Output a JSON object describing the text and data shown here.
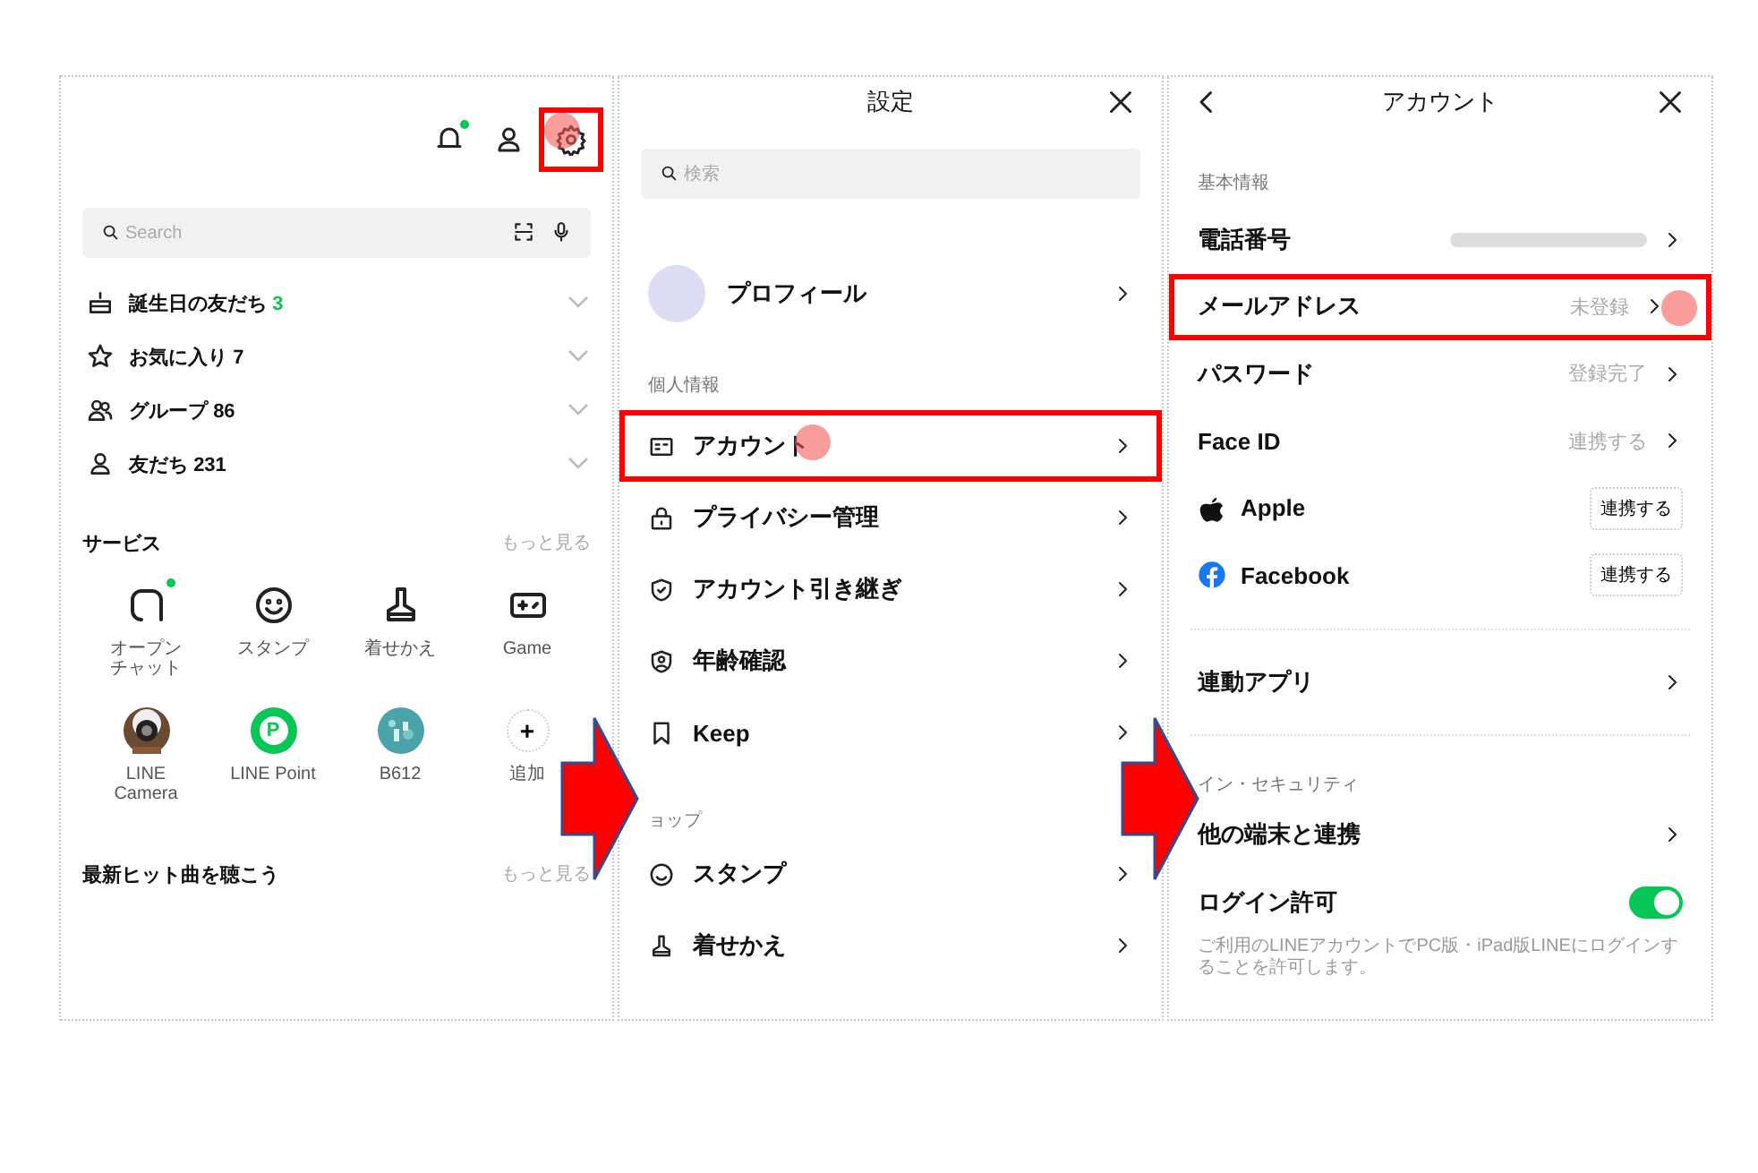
{
  "home": {
    "header_icons": [
      {
        "badge": true,
        "highlighted": false
      },
      {
        "badge": false,
        "highlighted": false
      },
      {
        "badge": false,
        "highlighted": true
      }
    ],
    "search": {
      "placeholder": "Search"
    },
    "friend_groups": [
      {
        "label": "誕生日の友だち",
        "count": "3",
        "accent": true
      },
      {
        "label": "お気に入り",
        "count": "7",
        "accent": false
      },
      {
        "label": "グループ",
        "count": "86",
        "accent": false
      },
      {
        "label": "友だち",
        "count": "231",
        "accent": false
      }
    ],
    "services": {
      "title": "サービス",
      "more": "もっと見る",
      "items": [
        {
          "lines": [
            "オープン",
            "チャット"
          ],
          "badge": true
        },
        {
          "lines": [
            "スタンプ"
          ],
          "badge": false
        },
        {
          "lines": [
            "着せかえ"
          ],
          "badge": false
        },
        {
          "lines": [
            "Game"
          ],
          "badge": false
        },
        {
          "lines": [
            "LINE",
            "Camera"
          ],
          "badge": false
        },
        {
          "lines": [
            "LINE Point"
          ],
          "badge": false,
          "glyph": "P"
        },
        {
          "lines": [
            "B612"
          ],
          "badge": false
        },
        {
          "lines": [
            "追加"
          ],
          "badge": false,
          "glyph": "+"
        }
      ]
    },
    "music": {
      "title": "最新ヒット曲を聴こう",
      "more": "もっと見る"
    }
  },
  "settings": {
    "title": "設定",
    "search": {
      "placeholder": "検索"
    },
    "profile": {
      "label": "プロフィール"
    },
    "sections": [
      {
        "title": "個人情報",
        "items": [
          {
            "label": "アカウント",
            "highlighted": true
          },
          {
            "label": "プライバシー管理",
            "highlighted": false
          },
          {
            "label": "アカウント引き継ぎ",
            "highlighted": false
          },
          {
            "label": "年齢確認",
            "highlighted": false
          },
          {
            "label": "Keep",
            "highlighted": false
          }
        ]
      },
      {
        "title": "ョップ",
        "items": [
          {
            "label": "スタンプ",
            "highlighted": false
          },
          {
            "label": "着せかえ",
            "highlighted": false
          }
        ]
      }
    ]
  },
  "account": {
    "title": "アカウント",
    "sections": [
      {
        "title": "基本情報",
        "items": [
          {
            "kind": "redacted",
            "label": "電話番号",
            "highlighted": false
          },
          {
            "kind": "link",
            "label": "メールアドレス",
            "value": "未登録",
            "highlighted": true
          },
          {
            "kind": "link",
            "label": "パスワード",
            "value": "登録完了",
            "highlighted": false
          },
          {
            "kind": "link",
            "label": "Face ID",
            "value": "連携する",
            "highlighted": false
          },
          {
            "kind": "button",
            "label": "Apple",
            "button": "連携する",
            "highlighted": false
          },
          {
            "kind": "button",
            "label": "Facebook",
            "button": "連携する",
            "highlighted": false
          }
        ]
      },
      {
        "items": [
          {
            "kind": "link",
            "label": "連動アプリ",
            "highlighted": false
          }
        ]
      },
      {
        "title": "イン・セキュリティ",
        "items": [
          {
            "kind": "link",
            "label": "他の端末と連携",
            "highlighted": false
          },
          {
            "kind": "toggle",
            "label": "ログイン許可",
            "on": true,
            "description": "ご利用のLINEアカウントでPC版・iPad版LINEにログインすることを許可します。",
            "highlighted": false
          }
        ]
      }
    ]
  }
}
